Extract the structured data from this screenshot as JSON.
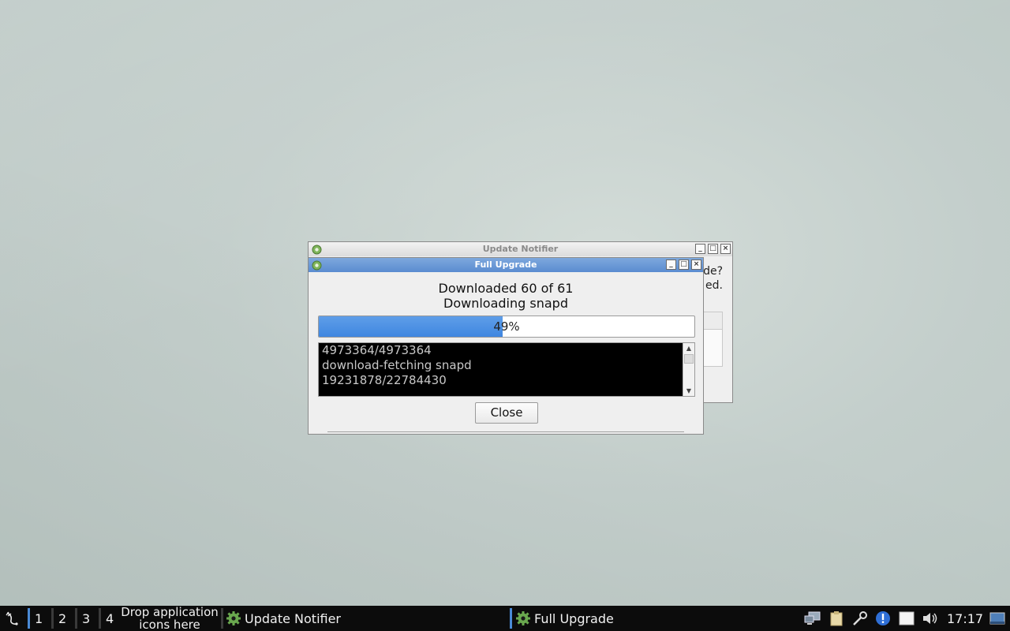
{
  "desktop": {
    "background_color": "#c3cecb"
  },
  "notifier_window": {
    "title": "Update Notifier",
    "body_lines": [
      "de?",
      "ed."
    ]
  },
  "upgrade_window": {
    "title": "Full Upgrade",
    "status_line_1": "Downloaded 60 of 61",
    "status_line_2": "Downloading snapd",
    "progress": {
      "percent": 49,
      "label": "49%",
      "color": "#3f86e0"
    },
    "log_lines": [
      "4973364/4973364",
      "download-fetching snapd",
      "19231878/22784430"
    ],
    "close_label": "Close"
  },
  "window_buttons": {
    "minimize": "minimize-icon",
    "maximize": "maximize-icon",
    "close": "close-icon"
  },
  "taskbar": {
    "start_icon": "lxde-start-icon",
    "desktops": [
      "1",
      "2",
      "3",
      "4"
    ],
    "drop_hint_line_1": "Drop application",
    "drop_hint_line_2": "icons here",
    "tasks": [
      {
        "label": "Update Notifier",
        "icon": "gear-icon"
      },
      {
        "label": "Full Upgrade",
        "icon": "gear-icon"
      }
    ],
    "tray_icons": [
      "network-icon",
      "clipboard-icon",
      "tools-icon",
      "info-icon",
      "notes-icon",
      "volume-icon"
    ],
    "clock": "17:17",
    "show_desktop_icon": "show-desktop-icon"
  }
}
